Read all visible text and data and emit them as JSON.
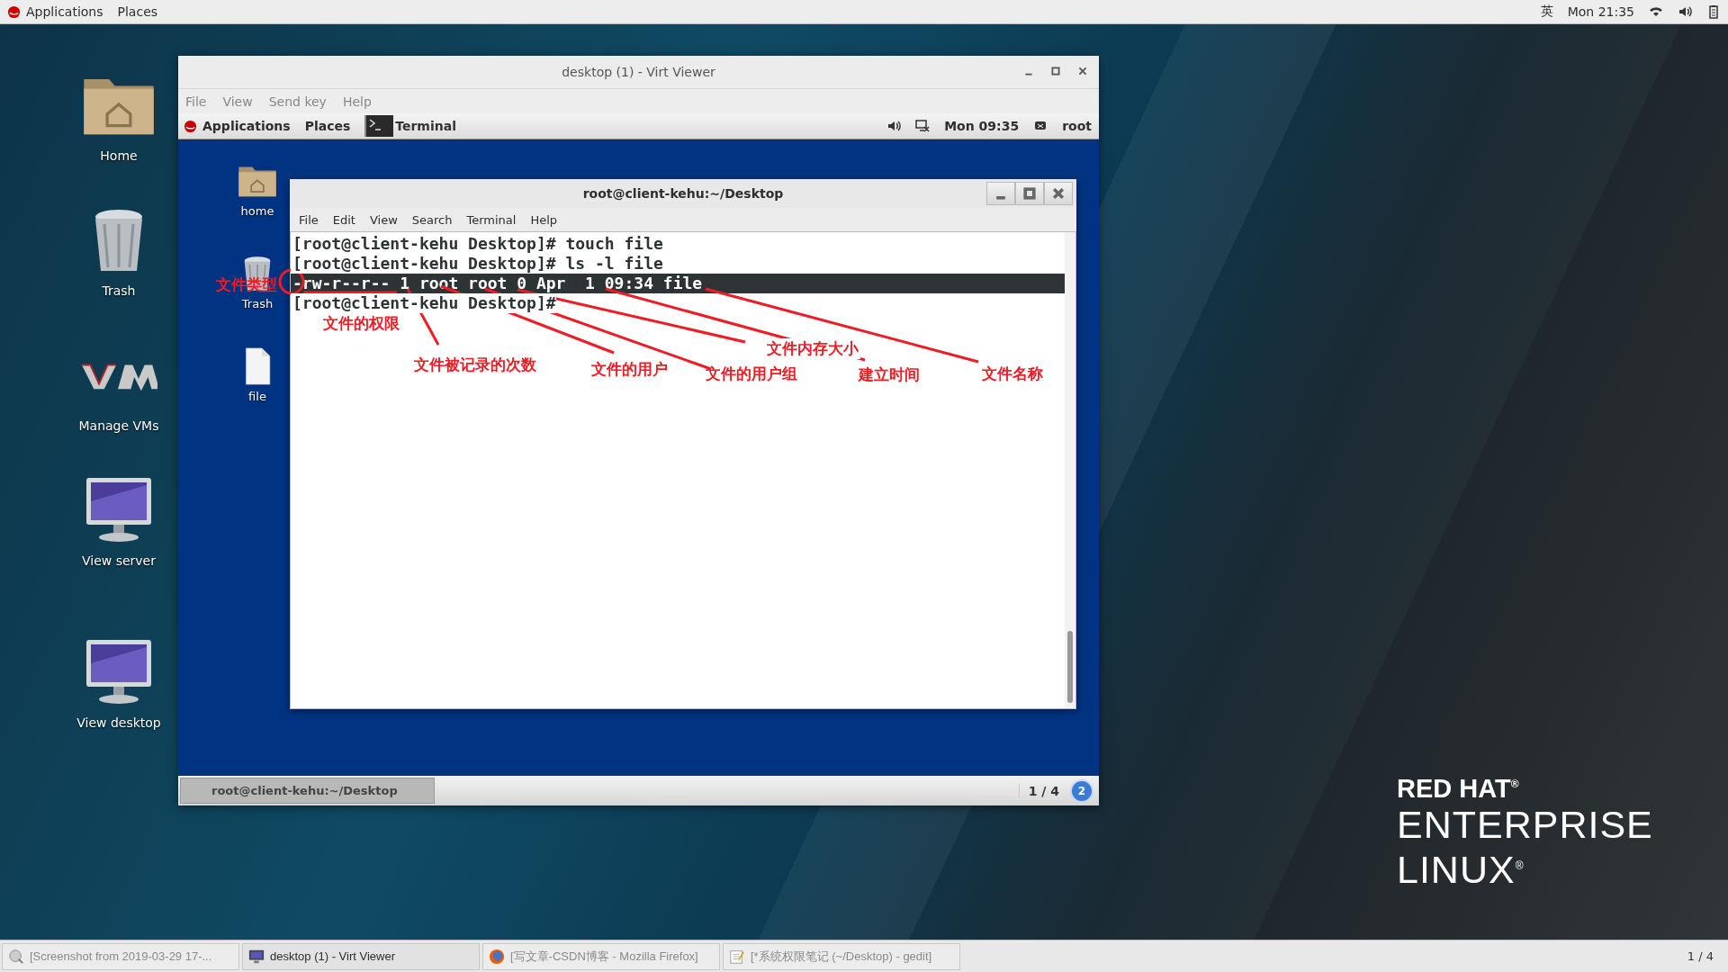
{
  "top_bar": {
    "menus": [
      "Applications",
      "Places"
    ],
    "input_method": "英",
    "clock": "Mon 21:35"
  },
  "desktop_icons": [
    {
      "label": "Home",
      "kind": "folder"
    },
    {
      "label": "Trash",
      "kind": "trash"
    },
    {
      "label": "Manage VMs",
      "kind": "vm"
    },
    {
      "label": "View server",
      "kind": "monitor"
    },
    {
      "label": "View desktop",
      "kind": "monitor"
    }
  ],
  "virt_viewer": {
    "title": "desktop (1) - Virt Viewer",
    "menus": [
      "File",
      "View",
      "Send key",
      "Help"
    ],
    "guest": {
      "top_bar": {
        "menus": [
          "Applications",
          "Places"
        ],
        "task": "Terminal",
        "clock": "Mon 09:35",
        "user": "root"
      },
      "desktop_icons": [
        {
          "label": "home",
          "kind": "folder"
        },
        {
          "label": "Trash",
          "kind": "trash"
        },
        {
          "label": "file",
          "kind": "file"
        }
      ],
      "terminal": {
        "title": "root@client-kehu:~/Desktop",
        "menus": [
          "File",
          "Edit",
          "View",
          "Search",
          "Terminal",
          "Help"
        ],
        "lines": [
          {
            "text": "[root@client-kehu Desktop]# touch file",
            "selected": false
          },
          {
            "text": "[root@client-kehu Desktop]# ls -l file",
            "selected": false
          },
          {
            "text": "-rw-r--r-- 1 root root 0 Apr  1 09:34 file",
            "selected": true
          },
          {
            "text": "[root@client-kehu Desktop]#",
            "selected": false
          }
        ]
      },
      "taskbar": {
        "task": "root@client-kehu:~/Desktop",
        "workspace": "1 / 4",
        "badge": "2"
      }
    }
  },
  "annotations": [
    {
      "label": "文件类型",
      "kind": "circle"
    },
    {
      "label": "文件的权限",
      "kind": "underline"
    },
    {
      "label": "文件被记录的次数",
      "kind": "leader"
    },
    {
      "label": "文件的用户",
      "kind": "leader"
    },
    {
      "label": "文件的用户组",
      "kind": "leader"
    },
    {
      "label": "文件内存大小",
      "kind": "leader"
    },
    {
      "label": "建立时间",
      "kind": "leader"
    },
    {
      "label": "文件名称",
      "kind": "leader"
    }
  ],
  "brand": {
    "lines": [
      "RED HAT$^{®}$",
      "ENTERPRISE",
      "LINUX$^{®}$"
    ]
  },
  "taskbar": [
    {
      "label": "[Screenshot from 2019-03-29 17-...",
      "kind": "image",
      "selected": false
    },
    {
      "label": "desktop (1) - Virt Viewer",
      "kind": "monitor",
      "selected": true
    },
    {
      "label": "[写文章-CSDN博客 - Mozilla Firefox]",
      "kind": "browser",
      "selected": false
    },
    {
      "label": "[*系统权限笔记 (~/Desktop) - gedit]",
      "kind": "editor",
      "selected": false
    }
  ],
  "workspace": "1 / 4"
}
